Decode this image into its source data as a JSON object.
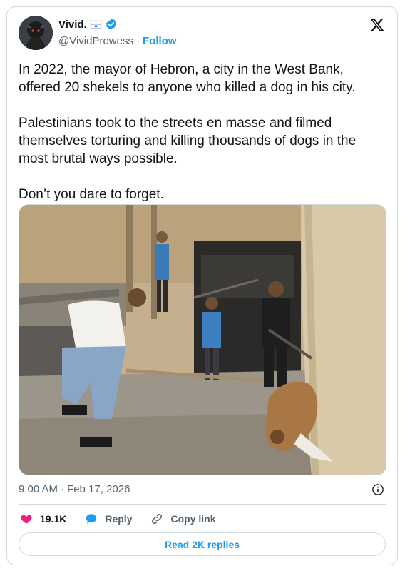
{
  "author": {
    "display_name": "Vivid.",
    "flag_icon": "israel-flag-icon",
    "verified_icon": "verified-badge-icon",
    "handle": "@VividProwess",
    "separator": "·",
    "follow_label": "Follow"
  },
  "brand": {
    "logo_icon": "x-logo-icon"
  },
  "tweet": {
    "paragraphs": [
      "In 2022, the mayor of Hebron, a city in the West Bank, offered 20 shekels to anyone who killed a dog in his city.",
      "Palestinians took to the streets en masse and filmed themselves torturing and killing thousands of dogs in the most brutal ways possible.",
      "Don’t you dare to forget."
    ]
  },
  "meta": {
    "time": "9:00 AM",
    "separator": "·",
    "date": "Feb 17, 2026",
    "info_icon": "info-icon"
  },
  "actions": {
    "like_count": "19.1K",
    "reply_label": "Reply",
    "copy_link_label": "Copy link"
  },
  "replies_button": {
    "label": "Read 2K replies"
  },
  "colors": {
    "accent": "#1d9bf0",
    "like": "#f91880",
    "text": "#0f1419",
    "muted": "#536471",
    "border": "#cfd9de"
  }
}
